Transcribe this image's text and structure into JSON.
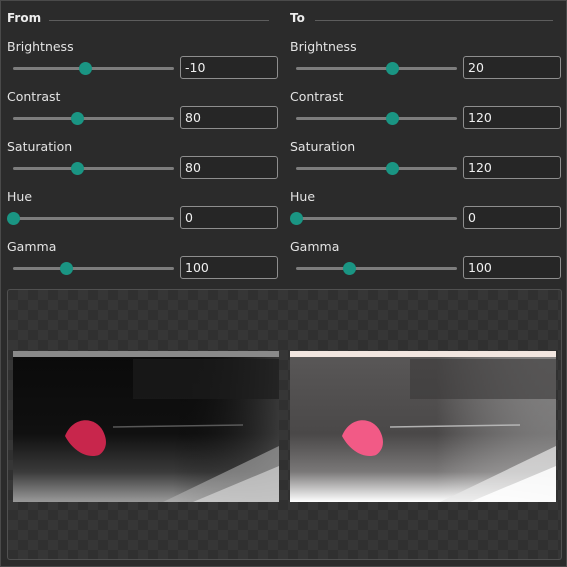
{
  "from": {
    "title": "From",
    "params": [
      {
        "label": "Brightness",
        "value": "-10",
        "slider_fraction": 0.45
      },
      {
        "label": "Contrast",
        "value": "80",
        "slider_fraction": 0.4
      },
      {
        "label": "Saturation",
        "value": "80",
        "slider_fraction": 0.4
      },
      {
        "label": "Hue",
        "value": "0",
        "slider_fraction": 0.0
      },
      {
        "label": "Gamma",
        "value": "100",
        "slider_fraction": 0.33
      }
    ]
  },
  "to": {
    "title": "To",
    "params": [
      {
        "label": "Brightness",
        "value": "20",
        "slider_fraction": 0.6
      },
      {
        "label": "Contrast",
        "value": "120",
        "slider_fraction": 0.6
      },
      {
        "label": "Saturation",
        "value": "120",
        "slider_fraction": 0.6
      },
      {
        "label": "Hue",
        "value": "0",
        "slider_fraction": 0.0
      },
      {
        "label": "Gamma",
        "value": "100",
        "slider_fraction": 0.33
      }
    ]
  },
  "colors": {
    "accent": "#1a9583",
    "background": "#2b2b2b",
    "input_border": "#8e8e8e"
  }
}
